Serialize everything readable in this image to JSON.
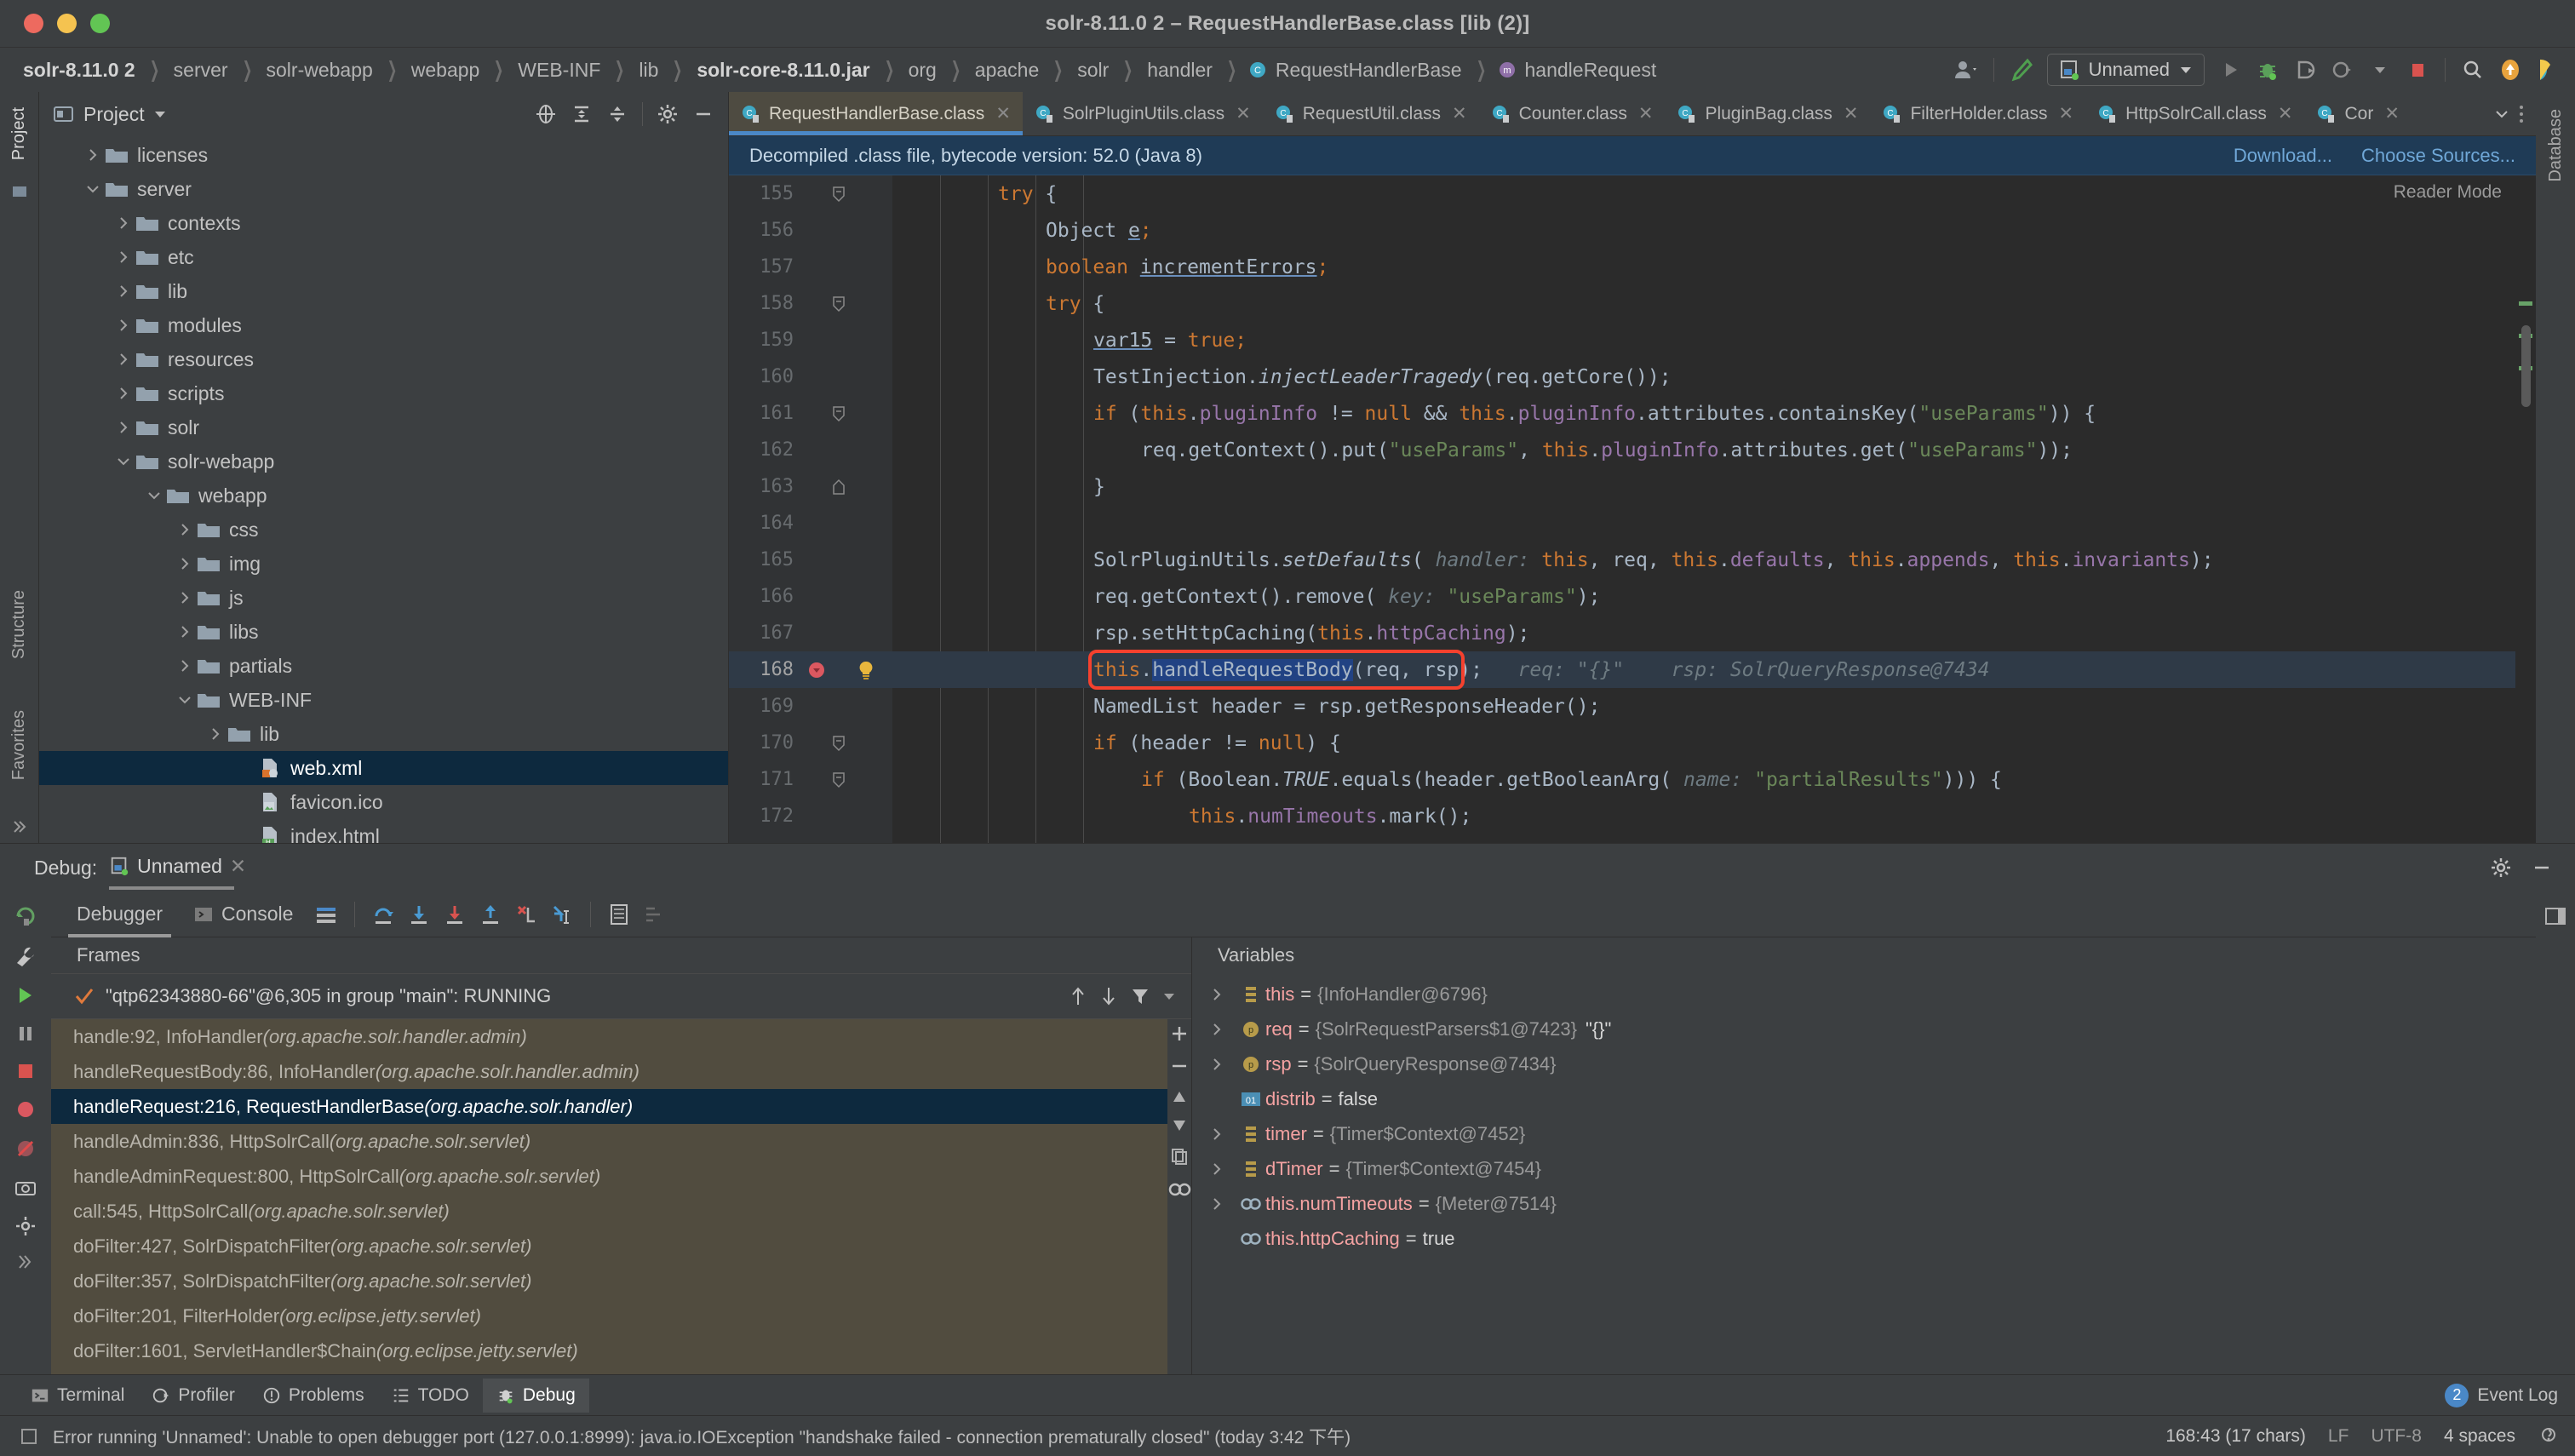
{
  "window": {
    "title": "solr-8.11.0 2 – RequestHandlerBase.class [lib (2)]"
  },
  "breadcrumb": [
    {
      "label": "solr-8.11.0 2",
      "bold": true,
      "icon": "none"
    },
    {
      "label": "server",
      "bold": false,
      "icon": "none"
    },
    {
      "label": "solr-webapp",
      "bold": false,
      "icon": "none"
    },
    {
      "label": "webapp",
      "bold": false,
      "icon": "none"
    },
    {
      "label": "WEB-INF",
      "bold": false,
      "icon": "none"
    },
    {
      "label": "lib",
      "bold": false,
      "icon": "none"
    },
    {
      "label": "solr-core-8.11.0.jar",
      "bold": true,
      "icon": "none"
    },
    {
      "label": "org",
      "bold": false,
      "icon": "none"
    },
    {
      "label": "apache",
      "bold": false,
      "icon": "none"
    },
    {
      "label": "solr",
      "bold": false,
      "icon": "none"
    },
    {
      "label": "handler",
      "bold": false,
      "icon": "none"
    },
    {
      "label": "RequestHandlerBase",
      "bold": false,
      "icon": "class-icon"
    },
    {
      "label": "handleRequest",
      "bold": false,
      "icon": "method-icon"
    }
  ],
  "toolbar": {
    "run_config": "Unnamed",
    "icons": [
      "user-account-icon",
      "hammer-build-icon",
      "run-icon",
      "debug-icon",
      "run-with-coverage-icon",
      "profile-icon",
      "stop-icon",
      "search-icon",
      "update-icon",
      "ide-logo-icon"
    ]
  },
  "project_panel": {
    "title": "Project",
    "header_icons": [
      "locate-icon",
      "expand-all-icon",
      "collapse-all-icon",
      "gear-icon",
      "hide-icon"
    ],
    "tree": [
      {
        "label": "licenses",
        "depth": 1,
        "state": "collapsed",
        "kind": "folder",
        "selected": false
      },
      {
        "label": "server",
        "depth": 1,
        "state": "expanded",
        "kind": "folder",
        "selected": false
      },
      {
        "label": "contexts",
        "depth": 2,
        "state": "collapsed",
        "kind": "folder",
        "selected": false
      },
      {
        "label": "etc",
        "depth": 2,
        "state": "collapsed",
        "kind": "folder",
        "selected": false
      },
      {
        "label": "lib",
        "depth": 2,
        "state": "collapsed",
        "kind": "folder",
        "selected": false
      },
      {
        "label": "modules",
        "depth": 2,
        "state": "collapsed",
        "kind": "folder",
        "selected": false
      },
      {
        "label": "resources",
        "depth": 2,
        "state": "collapsed",
        "kind": "folder",
        "selected": false
      },
      {
        "label": "scripts",
        "depth": 2,
        "state": "collapsed",
        "kind": "folder",
        "selected": false
      },
      {
        "label": "solr",
        "depth": 2,
        "state": "collapsed",
        "kind": "folder",
        "selected": false
      },
      {
        "label": "solr-webapp",
        "depth": 2,
        "state": "expanded",
        "kind": "folder",
        "selected": false
      },
      {
        "label": "webapp",
        "depth": 3,
        "state": "expanded",
        "kind": "folder",
        "selected": false
      },
      {
        "label": "css",
        "depth": 4,
        "state": "collapsed",
        "kind": "folder",
        "selected": false
      },
      {
        "label": "img",
        "depth": 4,
        "state": "collapsed",
        "kind": "folder",
        "selected": false
      },
      {
        "label": "js",
        "depth": 4,
        "state": "collapsed",
        "kind": "folder",
        "selected": false
      },
      {
        "label": "libs",
        "depth": 4,
        "state": "collapsed",
        "kind": "folder",
        "selected": false
      },
      {
        "label": "partials",
        "depth": 4,
        "state": "collapsed",
        "kind": "folder",
        "selected": false
      },
      {
        "label": "WEB-INF",
        "depth": 4,
        "state": "expanded",
        "kind": "folder",
        "selected": false
      },
      {
        "label": "lib",
        "depth": 5,
        "state": "collapsed",
        "kind": "folder",
        "selected": false
      },
      {
        "label": "web.xml",
        "depth": 6,
        "state": "leaf",
        "kind": "xml-file",
        "selected": true
      },
      {
        "label": "favicon.ico",
        "depth": 6,
        "state": "leaf",
        "kind": "image-file",
        "selected": false
      },
      {
        "label": "index.html",
        "depth": 6,
        "state": "leaf",
        "kind": "html-file",
        "selected": false
      }
    ]
  },
  "editor": {
    "tabs": [
      {
        "label": "RequestHandlerBase.class",
        "active": true
      },
      {
        "label": "SolrPluginUtils.class",
        "active": false
      },
      {
        "label": "RequestUtil.class",
        "active": false
      },
      {
        "label": "Counter.class",
        "active": false
      },
      {
        "label": "PluginBag.class",
        "active": false
      },
      {
        "label": "FilterHolder.class",
        "active": false
      },
      {
        "label": "HttpSolrCall.class",
        "active": false
      },
      {
        "label": "Cor",
        "active": false
      }
    ],
    "notification": {
      "text": "Decompiled .class file, bytecode version: 52.0 (Java 8)",
      "actions": [
        "Download...",
        "Choose Sources..."
      ]
    },
    "reader_mode": "Reader Mode",
    "first_line_number": 155,
    "current_line_number": 168,
    "lines": [
      {
        "num": 155,
        "fold": "minus",
        "indent": 2,
        "tokens": [
          {
            "t": "try",
            "c": "kw"
          },
          {
            "t": " {",
            "c": "pl"
          }
        ]
      },
      {
        "num": 156,
        "fold": "",
        "indent": 3,
        "tokens": [
          {
            "t": "Object ",
            "c": "pl"
          },
          {
            "t": "e",
            "c": "ul"
          },
          {
            "t": ";",
            "c": "kw"
          }
        ]
      },
      {
        "num": 157,
        "fold": "",
        "indent": 3,
        "tokens": [
          {
            "t": "boolean ",
            "c": "kw"
          },
          {
            "t": "incrementErrors",
            "c": "ul"
          },
          {
            "t": ";",
            "c": "kw"
          }
        ]
      },
      {
        "num": 158,
        "fold": "minus",
        "indent": 3,
        "tokens": [
          {
            "t": "try",
            "c": "kw"
          },
          {
            "t": " {",
            "c": "pl"
          }
        ]
      },
      {
        "num": 159,
        "fold": "",
        "indent": 4,
        "tokens": [
          {
            "t": "var15",
            "c": "ul"
          },
          {
            "t": " = ",
            "c": "pl"
          },
          {
            "t": "true",
            "c": "kw"
          },
          {
            "t": ";",
            "c": "kw"
          }
        ]
      },
      {
        "num": 160,
        "fold": "",
        "indent": 4,
        "tokens": [
          {
            "t": "TestInjection.",
            "c": "pl"
          },
          {
            "t": "injectLeaderTragedy",
            "c": "sta"
          },
          {
            "t": "(req.getCore());",
            "c": "pl"
          }
        ]
      },
      {
        "num": 161,
        "fold": "minus",
        "indent": 4,
        "tokens": [
          {
            "t": "if ",
            "c": "kw"
          },
          {
            "t": "(",
            "c": "pl"
          },
          {
            "t": "this",
            "c": "kw"
          },
          {
            "t": ".",
            "c": "pl"
          },
          {
            "t": "pluginInfo",
            "c": "fld"
          },
          {
            "t": " != ",
            "c": "pl"
          },
          {
            "t": "null",
            "c": "kw"
          },
          {
            "t": " && ",
            "c": "pl"
          },
          {
            "t": "this",
            "c": "kw"
          },
          {
            "t": ".",
            "c": "pl"
          },
          {
            "t": "pluginInfo",
            "c": "fld"
          },
          {
            "t": ".attributes.containsKey(",
            "c": "pl"
          },
          {
            "t": "\"useParams\"",
            "c": "str"
          },
          {
            "t": ")) {",
            "c": "pl"
          }
        ]
      },
      {
        "num": 162,
        "fold": "",
        "indent": 5,
        "tokens": [
          {
            "t": "req.getContext().put(",
            "c": "pl"
          },
          {
            "t": "\"useParams\"",
            "c": "str"
          },
          {
            "t": ", ",
            "c": "pl"
          },
          {
            "t": "this",
            "c": "kw"
          },
          {
            "t": ".",
            "c": "pl"
          },
          {
            "t": "pluginInfo",
            "c": "fld"
          },
          {
            "t": ".attributes.get(",
            "c": "pl"
          },
          {
            "t": "\"useParams\"",
            "c": "str"
          },
          {
            "t": "));",
            "c": "pl"
          }
        ]
      },
      {
        "num": 163,
        "fold": "plus",
        "indent": 4,
        "tokens": [
          {
            "t": "}",
            "c": "pl"
          }
        ]
      },
      {
        "num": 164,
        "fold": "",
        "indent": 0,
        "tokens": []
      },
      {
        "num": 165,
        "fold": "",
        "indent": 4,
        "tokens": [
          {
            "t": "SolrPluginUtils.",
            "c": "pl"
          },
          {
            "t": "setDefaults",
            "c": "sta"
          },
          {
            "t": "( ",
            "c": "pl"
          },
          {
            "t": "handler:",
            "c": "hint"
          },
          {
            "t": " ",
            "c": "pl"
          },
          {
            "t": "this",
            "c": "kw"
          },
          {
            "t": ", req, ",
            "c": "pl"
          },
          {
            "t": "this",
            "c": "kw"
          },
          {
            "t": ".",
            "c": "pl"
          },
          {
            "t": "defaults",
            "c": "fld"
          },
          {
            "t": ", ",
            "c": "pl"
          },
          {
            "t": "this",
            "c": "kw"
          },
          {
            "t": ".",
            "c": "pl"
          },
          {
            "t": "appends",
            "c": "fld"
          },
          {
            "t": ", ",
            "c": "pl"
          },
          {
            "t": "this",
            "c": "kw"
          },
          {
            "t": ".",
            "c": "pl"
          },
          {
            "t": "invariants",
            "c": "fld"
          },
          {
            "t": ");",
            "c": "pl"
          }
        ]
      },
      {
        "num": 166,
        "fold": "",
        "indent": 4,
        "tokens": [
          {
            "t": "req.getContext().remove( ",
            "c": "pl"
          },
          {
            "t": "key:",
            "c": "hint"
          },
          {
            "t": " ",
            "c": "pl"
          },
          {
            "t": "\"useParams\"",
            "c": "str"
          },
          {
            "t": ");",
            "c": "pl"
          }
        ]
      },
      {
        "num": 167,
        "fold": "",
        "indent": 4,
        "tokens": [
          {
            "t": "rsp.setHttpCaching(",
            "c": "pl"
          },
          {
            "t": "this",
            "c": "kw"
          },
          {
            "t": ".",
            "c": "pl"
          },
          {
            "t": "httpCaching",
            "c": "fld"
          },
          {
            "t": ");",
            "c": "pl"
          }
        ]
      },
      {
        "num": 168,
        "fold": "",
        "indent": 4,
        "current": true,
        "breakpoint": true,
        "bulb": true,
        "tokens": [
          {
            "t": "this",
            "c": "kw"
          },
          {
            "t": ".",
            "c": "pl"
          },
          {
            "t": "handleRequestBody",
            "c": "selbg"
          },
          {
            "t": "(req, rsp);",
            "c": "pl"
          },
          {
            "t": "   ",
            "c": "pl"
          },
          {
            "t": "req:",
            "c": "hint"
          },
          {
            "t": " ",
            "c": "pl"
          },
          {
            "t": "\"{}\"",
            "c": "hintstr"
          },
          {
            "t": "    ",
            "c": "pl"
          },
          {
            "t": "rsp:",
            "c": "hint"
          },
          {
            "t": " ",
            "c": "pl"
          },
          {
            "t": "SolrQueryResponse@7434",
            "c": "hint"
          }
        ]
      },
      {
        "num": 169,
        "fold": "",
        "indent": 4,
        "tokens": [
          {
            "t": "NamedList header = rsp.getResponseHeader();",
            "c": "pl"
          }
        ]
      },
      {
        "num": 170,
        "fold": "minus",
        "indent": 4,
        "tokens": [
          {
            "t": "if ",
            "c": "kw"
          },
          {
            "t": "(header != ",
            "c": "pl"
          },
          {
            "t": "null",
            "c": "kw"
          },
          {
            "t": ") {",
            "c": "pl"
          }
        ]
      },
      {
        "num": 171,
        "fold": "minus",
        "indent": 5,
        "tokens": [
          {
            "t": "if ",
            "c": "kw"
          },
          {
            "t": "(Boolean.",
            "c": "pl"
          },
          {
            "t": "TRUE",
            "c": "sta"
          },
          {
            "t": ".equals(header.getBooleanArg( ",
            "c": "pl"
          },
          {
            "t": "name:",
            "c": "hint"
          },
          {
            "t": " ",
            "c": "pl"
          },
          {
            "t": "\"partialResults\"",
            "c": "str"
          },
          {
            "t": "))) {",
            "c": "pl"
          }
        ]
      },
      {
        "num": 172,
        "fold": "",
        "indent": 6,
        "tokens": [
          {
            "t": "this",
            "c": "kw"
          },
          {
            "t": ".",
            "c": "pl"
          },
          {
            "t": "numTimeouts",
            "c": "fld"
          },
          {
            "t": ".mark();",
            "c": "pl"
          }
        ]
      }
    ]
  },
  "debug": {
    "header_label": "Debug:",
    "session_name": "Unnamed",
    "tabs": [
      {
        "label": "Debugger",
        "active": true
      },
      {
        "label": "Console",
        "active": false
      }
    ],
    "frames_label": "Frames",
    "variables_label": "Variables",
    "thread": "\"qtp62343880-66\"@6,305 in group \"main\": RUNNING",
    "frames": [
      {
        "text": "handle:92, InfoHandler ",
        "pkg": "(org.apache.solr.handler.admin)",
        "selected": false
      },
      {
        "text": "handleRequestBody:86, InfoHandler ",
        "pkg": "(org.apache.solr.handler.admin)",
        "selected": false
      },
      {
        "text": "handleRequest:216, RequestHandlerBase ",
        "pkg": "(org.apache.solr.handler)",
        "selected": true
      },
      {
        "text": "handleAdmin:836, HttpSolrCall ",
        "pkg": "(org.apache.solr.servlet)",
        "selected": false
      },
      {
        "text": "handleAdminRequest:800, HttpSolrCall ",
        "pkg": "(org.apache.solr.servlet)",
        "selected": false
      },
      {
        "text": "call:545, HttpSolrCall ",
        "pkg": "(org.apache.solr.servlet)",
        "selected": false
      },
      {
        "text": "doFilter:427, SolrDispatchFilter ",
        "pkg": "(org.apache.solr.servlet)",
        "selected": false
      },
      {
        "text": "doFilter:357, SolrDispatchFilter ",
        "pkg": "(org.apache.solr.servlet)",
        "selected": false
      },
      {
        "text": "doFilter:201, FilterHolder ",
        "pkg": "(org.eclipse.jetty.servlet)",
        "selected": false
      },
      {
        "text": "doFilter:1601, ServletHandler$Chain ",
        "pkg": "(org.eclipse.jetty.servlet)",
        "selected": false
      }
    ],
    "variables": [
      {
        "twist": true,
        "icon": "field-icon",
        "name": "this",
        "value": "{InfoHandler@6796}",
        "extra": ""
      },
      {
        "twist": true,
        "icon": "param-icon",
        "name": "req",
        "value": "{SolrRequestParsers$1@7423}",
        "extra": "\"{}\""
      },
      {
        "twist": true,
        "icon": "param-icon",
        "name": "rsp",
        "value": "{SolrQueryResponse@7434}",
        "extra": ""
      },
      {
        "twist": false,
        "icon": "boolean-icon",
        "name": "distrib",
        "value": "false",
        "literal": true,
        "extra": ""
      },
      {
        "twist": true,
        "icon": "field-icon",
        "name": "timer",
        "value": "{Timer$Context@7452}",
        "extra": ""
      },
      {
        "twist": true,
        "icon": "field-icon",
        "name": "dTimer",
        "value": "{Timer$Context@7454}",
        "extra": ""
      },
      {
        "twist": true,
        "icon": "watch-icon",
        "name": "this.numTimeouts",
        "value": "{Meter@7514}",
        "extra": ""
      },
      {
        "twist": false,
        "icon": "watch-icon",
        "name": "this.httpCaching",
        "value": "true",
        "literal": true,
        "extra": ""
      }
    ]
  },
  "left_rail": [
    "Project",
    "Database",
    "Structure",
    "Favorites"
  ],
  "bottom_tools": [
    {
      "label": "Debug",
      "icon": "debug-icon",
      "active": true
    },
    {
      "label": "TODO",
      "icon": "todo-icon",
      "active": false
    },
    {
      "label": "Problems",
      "icon": "problems-icon",
      "active": false
    },
    {
      "label": "Profiler",
      "icon": "profiler-icon",
      "active": false
    },
    {
      "label": "Terminal",
      "icon": "terminal-icon",
      "active": false
    }
  ],
  "event_log": {
    "count": "2",
    "label": "Event Log"
  },
  "status": {
    "message": "Error running 'Unnamed': Unable to open debugger port (127.0.0.1:8999): java.io.IOException \"handshake failed - connection prematurally closed\" (today 3:42 下午)",
    "caret": "168:43 (17 chars)",
    "line_sep": "LF",
    "encoding": "UTF-8",
    "indent": "4 spaces"
  },
  "colors": {
    "accent": "#4a88c7",
    "selection": "#0d293e",
    "editor_bg": "#2b2b2b",
    "panel_bg": "#3c3f41",
    "breakpoint_red": "#db5860",
    "highlight_box": "#f5412e",
    "frames_bg": "#514c3f"
  }
}
